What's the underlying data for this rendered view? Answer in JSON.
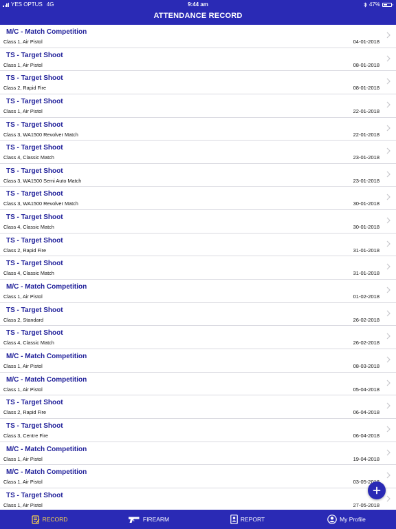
{
  "status_bar": {
    "carrier": "YES OPTUS",
    "network": "4G",
    "time": "9:44 am",
    "battery": "47%",
    "battery_level": 0.47
  },
  "header": {
    "title": "ATTENDANCE RECORD"
  },
  "records": [
    {
      "title": "M/C - Match Competition",
      "subtitle": "Class 1, Air Pistol",
      "date": "04-01-2018"
    },
    {
      "title": "TS - Target Shoot",
      "subtitle": "Class 1, Air Pistol",
      "date": "08-01-2018"
    },
    {
      "title": "TS - Target Shoot",
      "subtitle": "Class 2, Rapid Fire",
      "date": "08-01-2018"
    },
    {
      "title": "TS - Target Shoot",
      "subtitle": "Class 1, Air Pistol",
      "date": "22-01-2018"
    },
    {
      "title": "TS - Target Shoot",
      "subtitle": "Class 3, WA1500 Revolver Match",
      "date": "22-01-2018"
    },
    {
      "title": "TS - Target Shoot",
      "subtitle": "Class 4, Classic Match",
      "date": "23-01-2018"
    },
    {
      "title": "TS - Target Shoot",
      "subtitle": "Class 3, WA1500 Semi Auto Match",
      "date": "23-01-2018"
    },
    {
      "title": "TS - Target Shoot",
      "subtitle": "Class 3, WA1500 Revolver Match",
      "date": "30-01-2018"
    },
    {
      "title": "TS - Target Shoot",
      "subtitle": "Class 4, Classic Match",
      "date": "30-01-2018"
    },
    {
      "title": "TS - Target Shoot",
      "subtitle": "Class 2, Rapid Fire",
      "date": "31-01-2018"
    },
    {
      "title": "TS - Target Shoot",
      "subtitle": "Class 4, Classic Match",
      "date": "31-01-2018"
    },
    {
      "title": "M/C - Match Competition",
      "subtitle": "Class 1, Air Pistol",
      "date": "01-02-2018"
    },
    {
      "title": "TS - Target Shoot",
      "subtitle": "Class 2, Standard",
      "date": "26-02-2018"
    },
    {
      "title": "TS - Target Shoot",
      "subtitle": "Class 4, Classic Match",
      "date": "26-02-2018"
    },
    {
      "title": "M/C - Match Competition",
      "subtitle": "Class 1, Air Pistol",
      "date": "08-03-2018"
    },
    {
      "title": "M/C - Match Competition",
      "subtitle": "Class 1, Air Pistol",
      "date": "05-04-2018"
    },
    {
      "title": "TS - Target Shoot",
      "subtitle": "Class 2, Rapid Fire",
      "date": "06-04-2018"
    },
    {
      "title": "TS - Target Shoot",
      "subtitle": "Class 3, Centre Fire",
      "date": "06-04-2018"
    },
    {
      "title": "M/C - Match Competition",
      "subtitle": "Class 1, Air Pistol",
      "date": "19-04-2018"
    },
    {
      "title": "M/C - Match Competition",
      "subtitle": "Class 1, Air Pistol",
      "date": "03-05-2018"
    },
    {
      "title": "TS - Target Shoot",
      "subtitle": "Class 1, Air Pistol",
      "date": "27-05-2018"
    }
  ],
  "fab": {
    "icon": "plus-icon",
    "label": "+"
  },
  "tabs": [
    {
      "label": "RECORD",
      "icon": "record-icon",
      "active": true
    },
    {
      "label": "FIREARM",
      "icon": "firearm-icon",
      "active": false
    },
    {
      "label": "REPORT",
      "icon": "report-icon",
      "active": false
    },
    {
      "label": "My Profile",
      "icon": "profile-icon",
      "active": false
    }
  ],
  "colors": {
    "primary": "#2a2ab5",
    "title_text": "#21219a",
    "active_tab": "#ffd84a",
    "chevron": "#c7c7cc"
  }
}
